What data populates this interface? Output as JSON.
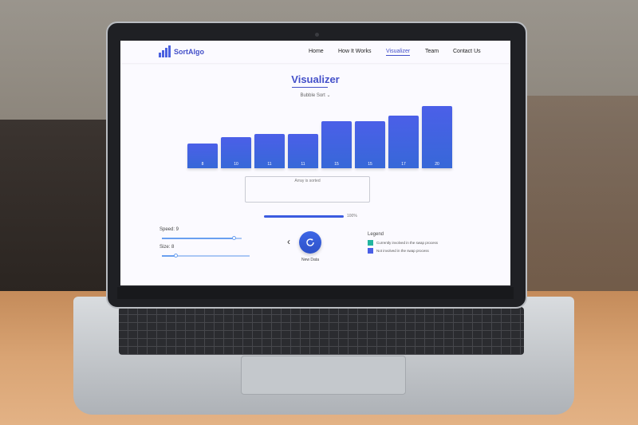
{
  "app": {
    "logo_text": "SortAlgo",
    "nav": [
      "Home",
      "How It Works",
      "Visualizer",
      "Team",
      "Contact Us"
    ],
    "active_nav": "Visualizer"
  },
  "visualizer": {
    "title": "Visualizer",
    "algorithm": "Bubble Sort",
    "values": [
      8,
      10,
      11,
      11,
      15,
      15,
      17,
      20
    ],
    "status_message": "Array is sorted",
    "progress_percent": 100,
    "progress_text": "100%"
  },
  "controls": {
    "speed_label": "Speed: 9",
    "speed_fraction": 0.9,
    "size_label": "Size: 8",
    "size_fraction": 0.15,
    "new_data_label": "New Data",
    "prev_icon": "chevron-left-icon",
    "refresh_icon": "refresh-icon"
  },
  "legend": {
    "title": "Legend",
    "items": [
      {
        "label": "Currently involved in the swap process",
        "color": "#22b5a0"
      },
      {
        "label": "Not involved in the swap process",
        "color": "#4a5fe6"
      }
    ]
  },
  "colors": {
    "accent": "#4450c9",
    "bar": "#4b5fe8"
  }
}
